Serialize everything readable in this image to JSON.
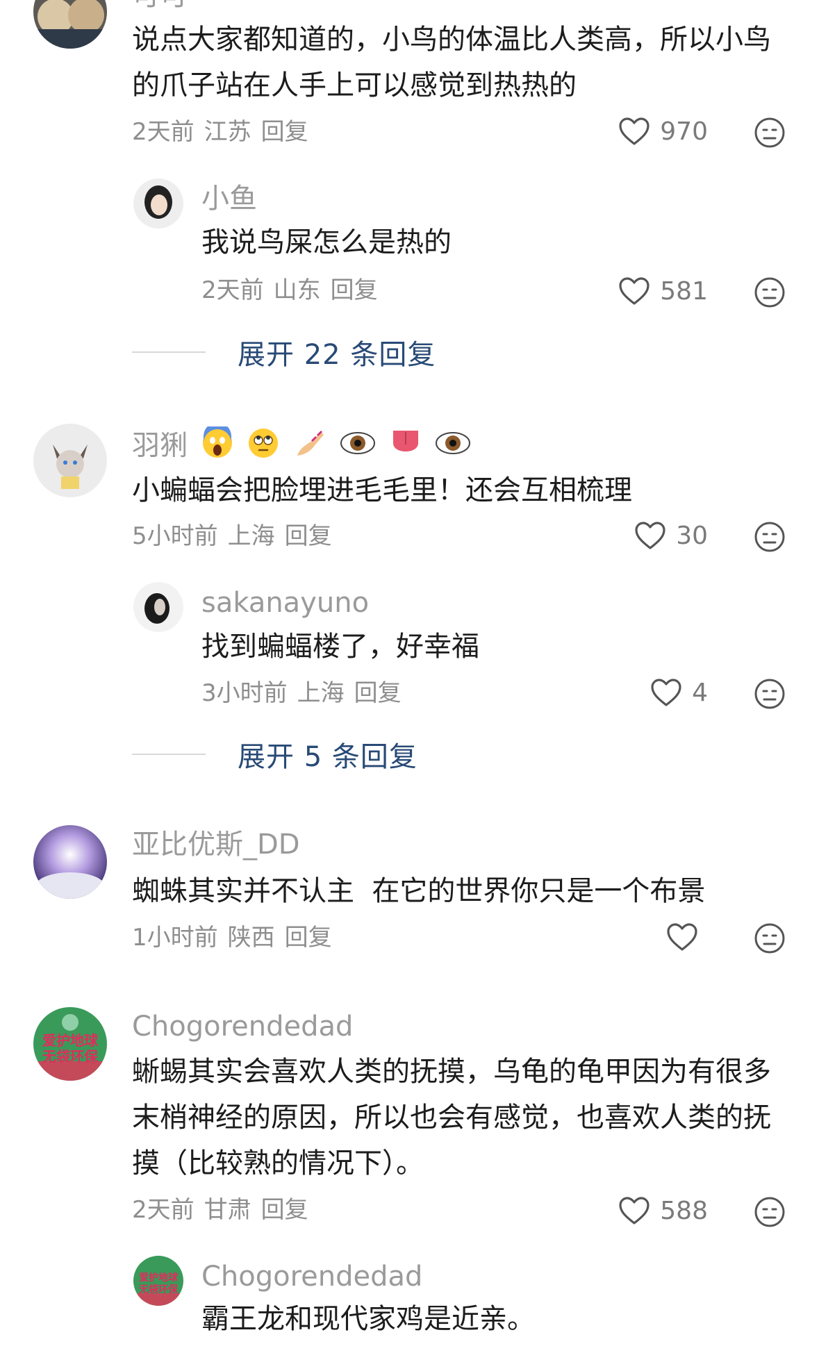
{
  "comments": [
    {
      "username": "可可",
      "text": "说点大家都知道的，小鸟的体温比人类高，所以小鸟的爪子站在人手上可以感觉到热热的",
      "time": "2天前",
      "location": "江苏",
      "reply_label": "回复",
      "likes": "970",
      "replies": [
        {
          "username": "小鱼",
          "text": "我说鸟屎怎么是热的",
          "time": "2天前",
          "location": "山东",
          "reply_label": "回复",
          "likes": "581"
        }
      ],
      "expand_label": "展开 22 条回复"
    },
    {
      "username": "羽猁",
      "text": "小蝙蝠会把脸埋进毛毛里！还会互相梳理",
      "time": "5小时前",
      "location": "上海",
      "reply_label": "回复",
      "likes": "30",
      "replies": [
        {
          "username": "sakanayuno",
          "text": "找到蝙蝠楼了，好幸福",
          "time": "3小时前",
          "location": "上海",
          "reply_label": "回复",
          "likes": "4"
        }
      ],
      "expand_label": "展开 5 条回复"
    },
    {
      "username": "亚比优斯_DD",
      "text": "蜘蛛其实并不认主  在它的世界你只是一个布景",
      "time": "1小时前",
      "location": "陕西",
      "reply_label": "回复",
      "likes": ""
    },
    {
      "username": "Chogorendedad",
      "text": "蜥蜴其实会喜欢人类的抚摸，乌龟的龟甲因为有很多末梢神经的原因，所以也会有感觉，也喜欢人类的抚摸（比较熟的情况下）。",
      "time": "2天前",
      "location": "甘肃",
      "reply_label": "回复",
      "likes": "588",
      "avatar_text": "爱护地球 无袋环保",
      "replies": [
        {
          "username": "Chogorendedad",
          "text": "霸王龙和现代家鸡是近亲。",
          "avatar_text": "爱护地球 无袋环保"
        }
      ]
    }
  ],
  "icons": {
    "like": "heart-outline-icon",
    "dislike": "neutral-face-icon"
  },
  "colors": {
    "username": "#9a9a9a",
    "text": "#1c1c1c",
    "meta": "#8e8e8e",
    "expand": "#284a76"
  }
}
